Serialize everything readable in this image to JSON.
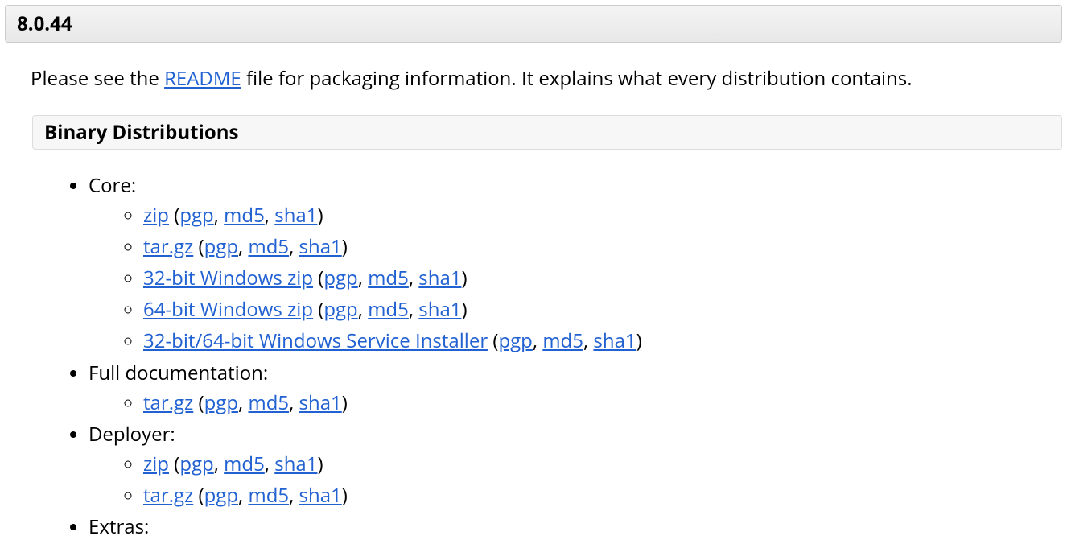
{
  "version": "8.0.44",
  "intro_prefix": "Please see the ",
  "intro_link": "README",
  "intro_suffix": " file for packaging information. It explains what every distribution contains.",
  "section_title": "Binary Distributions",
  "categories": [
    {
      "label": "Core:",
      "items": [
        {
          "main": "zip",
          "sigs": [
            "pgp",
            "md5",
            "sha1"
          ]
        },
        {
          "main": "tar.gz",
          "sigs": [
            "pgp",
            "md5",
            "sha1"
          ]
        },
        {
          "main": "32-bit Windows zip",
          "sigs": [
            "pgp",
            "md5",
            "sha1"
          ]
        },
        {
          "main": "64-bit Windows zip",
          "sigs": [
            "pgp",
            "md5",
            "sha1"
          ]
        },
        {
          "main": "32-bit/64-bit Windows Service Installer",
          "sigs": [
            "pgp",
            "md5",
            "sha1"
          ]
        }
      ]
    },
    {
      "label": "Full documentation:",
      "items": [
        {
          "main": "tar.gz",
          "sigs": [
            "pgp",
            "md5",
            "sha1"
          ]
        }
      ]
    },
    {
      "label": "Deployer:",
      "items": [
        {
          "main": "zip",
          "sigs": [
            "pgp",
            "md5",
            "sha1"
          ]
        },
        {
          "main": "tar.gz",
          "sigs": [
            "pgp",
            "md5",
            "sha1"
          ]
        }
      ]
    },
    {
      "label": "Extras:",
      "items": []
    }
  ]
}
